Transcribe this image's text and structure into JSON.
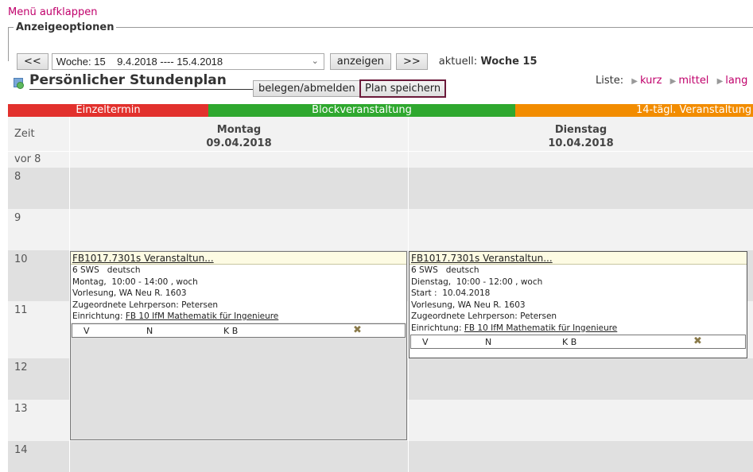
{
  "menu_link": "Menü aufklappen",
  "options": {
    "legend": "Anzeigeoptionen",
    "prev_btn": "<<",
    "week_select": "Woche: 15    9.4.2018 ---- 15.4.2018",
    "show_btn": "anzeigen",
    "next_btn": ">>",
    "current_label": "aktuell:",
    "current_value": "Woche 15"
  },
  "plan": {
    "title": "Persönlicher Stundenplan",
    "belegen_btn": "belegen/abmelden",
    "save_btn": "Plan speichern",
    "list_label": "Liste:",
    "list_short": "kurz",
    "list_medium": "mittel",
    "list_long": "lang"
  },
  "legend": {
    "single": "Einzeltermin",
    "block": "Blockveranstaltung",
    "biweekly": "14-tägl. Veranstaltung"
  },
  "grid": {
    "time_header": "Zeit",
    "days": [
      {
        "name": "Montag",
        "date": "09.04.2018"
      },
      {
        "name": "Dienstag",
        "date": "10.04.2018"
      }
    ],
    "times": [
      "vor 8",
      "8",
      "9",
      "10",
      "11",
      "12",
      "13",
      "14"
    ]
  },
  "events": [
    {
      "title": "FB1017.7301s Veranstaltun...",
      "lines": [
        "6 SWS   deutsch",
        "Montag,  10:00 - 14:00 , woch",
        "Vorlesung, WA Neu R. 1603",
        "Zugeordnete Lehrperson: Petersen"
      ],
      "inst_label": "Einrichtung: ",
      "inst_link": "FB 10 IfM Mathematik für Ingenieure",
      "foot": {
        "v": "V",
        "n": "N",
        "kb": "K B",
        "x": "✖"
      }
    },
    {
      "title": "FB1017.7301s Veranstaltun...",
      "lines": [
        "6 SWS   deutsch",
        "Dienstag,  10:00 - 12:00 , woch",
        "Start :  10.04.2018",
        "Vorlesung, WA Neu R. 1603",
        "Zugeordnete Lehrperson: Petersen"
      ],
      "inst_label": "Einrichtung: ",
      "inst_link": "FB 10 IfM Mathematik für Ingenieure",
      "foot": {
        "v": "V",
        "n": "N",
        "kb": "K B",
        "x": "✖"
      }
    }
  ],
  "colors": {
    "link": "#c0006b",
    "single": "#e2312d",
    "block": "#2fa82f",
    "biweekly": "#f28c00"
  }
}
